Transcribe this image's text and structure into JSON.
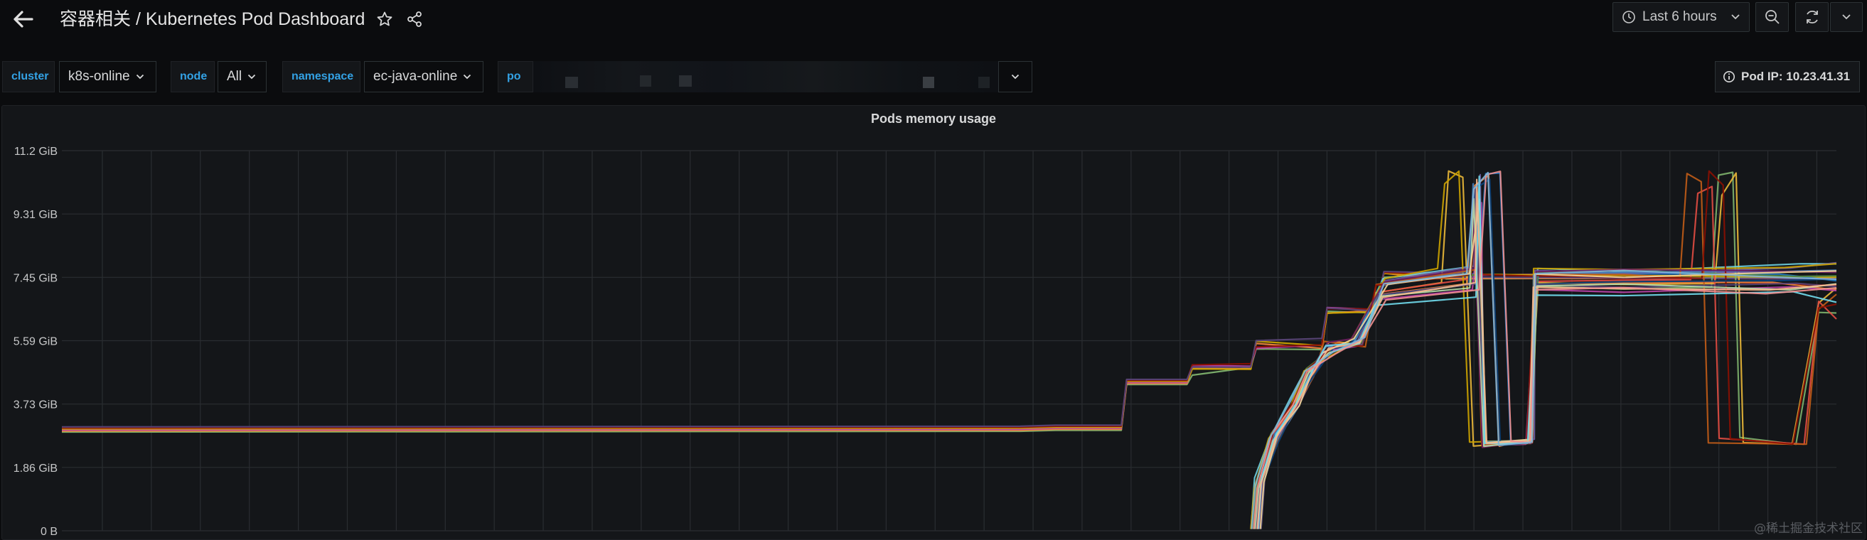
{
  "header": {
    "title": "容器相关 / Kubernetes Pod Dashboard",
    "time_range": "Last 6 hours"
  },
  "variables": [
    {
      "label": "cluster",
      "value": "k8s-online"
    },
    {
      "label": "node",
      "value": "All"
    },
    {
      "label": "namespace",
      "value": "ec-java-online"
    },
    {
      "label": "po",
      "value": ""
    }
  ],
  "pod_ip_label": "Pod IP: 10.23.41.31",
  "panel": {
    "title": "Pods memory usage"
  },
  "watermark": "@稀土掘金技术社区",
  "colors": {
    "accent": "#33a2e5",
    "background": "#0b0c0e",
    "panel": "#141619",
    "grid": "#2a2d31"
  },
  "chart_data": {
    "type": "line",
    "title": "Pods memory usage",
    "y_ticks": [
      "0 B",
      "1.86 GiB",
      "3.73 GiB",
      "5.59 GiB",
      "7.45 GiB",
      "9.31 GiB",
      "11.2 GiB"
    ],
    "ylim_gib": [
      0,
      11.2
    ],
    "xlim_fraction": [
      0,
      1
    ],
    "series_colors": [
      "#7eb26d",
      "#eab839",
      "#6ed0e0",
      "#ef843c",
      "#e24d42",
      "#1f78c1",
      "#ba43a9",
      "#705da0",
      "#508642",
      "#cca300",
      "#447ebc",
      "#c15c17",
      "#890f02",
      "#0a437c",
      "#6d1f62",
      "#584477",
      "#b7dbab",
      "#f4d598",
      "#70dbed",
      "#f9ba8f",
      "#f29191",
      "#82b5d8",
      "#e5a8e2",
      "#aea2e0"
    ],
    "series_note": "Dense multi-pod series; values in GiB over time fraction (0..1)",
    "baseline_series": [
      {
        "x": [
          0.0,
          0.54,
          0.56,
          0.597,
          0.6,
          0.634,
          0.637,
          0.67,
          0.673,
          0.71,
          0.713,
          0.74,
          0.745,
          0.775,
          0.78
        ],
        "y": [
          3.0,
          3.02,
          3.05,
          3.05,
          4.4,
          4.4,
          4.8,
          4.8,
          5.5,
          5.5,
          6.5,
          6.5,
          7.6,
          7.6,
          7.45
        ]
      }
    ],
    "late_series_start_x": 0.67,
    "plateau_range_gib": [
      6.9,
      7.8
    ],
    "spike_peak_gib": 10.6,
    "dip_gib": 2.45
  }
}
